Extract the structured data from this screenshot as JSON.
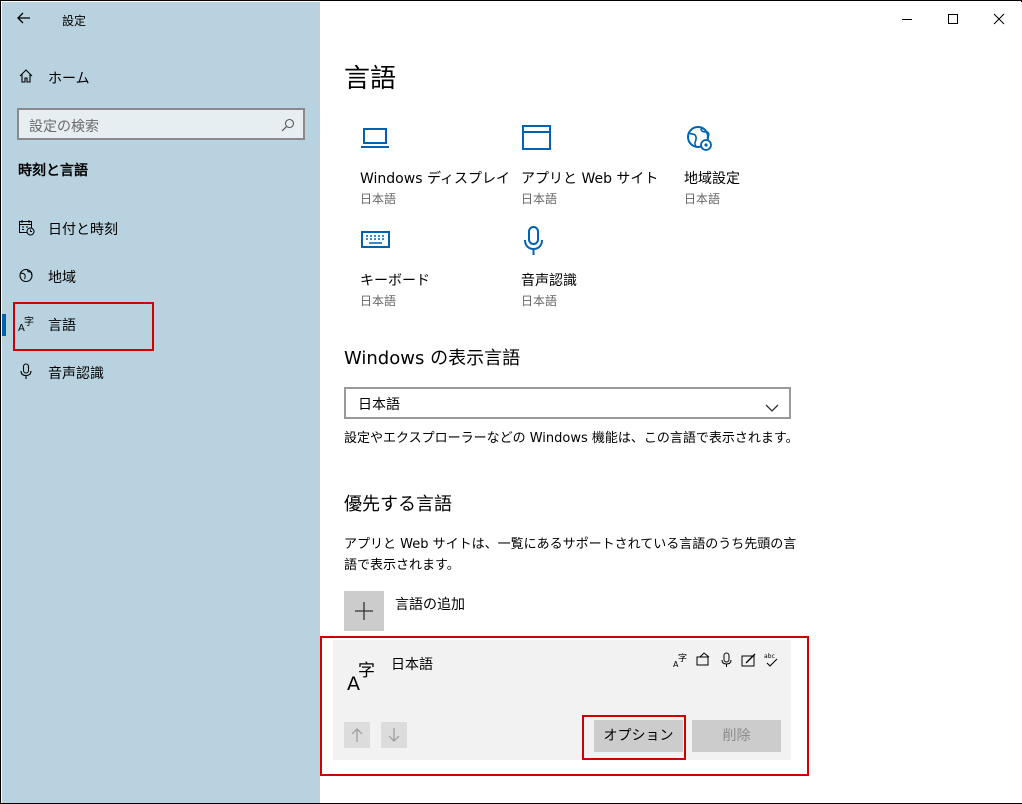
{
  "window": {
    "title": "設定"
  },
  "sidebar": {
    "home_label": "ホーム",
    "search_placeholder": "設定の検索",
    "section_title": "時刻と言語",
    "items": [
      {
        "label": "日付と時刻",
        "icon": "calendar-clock-icon"
      },
      {
        "label": "地域",
        "icon": "globe-icon"
      },
      {
        "label": "言語",
        "icon": "language-icon",
        "active": true
      },
      {
        "label": "音声認識",
        "icon": "microphone-icon"
      }
    ]
  },
  "main": {
    "title": "言語",
    "tiles": [
      {
        "title": "Windows ディスプレイ",
        "subtitle": "日本語",
        "icon": "laptop-icon"
      },
      {
        "title": "アプリと Web サイト",
        "subtitle": "日本語",
        "icon": "window-icon"
      },
      {
        "title": "地域設定",
        "subtitle": "日本語",
        "icon": "globe-settings-icon"
      },
      {
        "title": "キーボード",
        "subtitle": "日本語",
        "icon": "keyboard-icon"
      },
      {
        "title": "音声認識",
        "subtitle": "日本語",
        "icon": "microphone-icon"
      }
    ],
    "display_language": {
      "heading": "Windows の表示言語",
      "selected": "日本語",
      "description": "設定やエクスプローラーなどの Windows 機能は、この言語で表示されます。"
    },
    "preferred": {
      "heading": "優先する言語",
      "description": "アプリと Web サイトは、一覧にあるサポートされている言語のうち先頭の言語で表示されます。",
      "add_label": "言語の追加",
      "languages": [
        {
          "name": "日本語",
          "features": [
            "display-language-icon",
            "speech-icon",
            "voice-icon",
            "handwriting-icon",
            "spell-check-icon"
          ],
          "options_label": "オプション",
          "remove_label": "削除"
        }
      ]
    }
  },
  "colors": {
    "accent": "#0063b1",
    "sidebar_bg": "#b8d3df",
    "highlight": "#d00000"
  }
}
